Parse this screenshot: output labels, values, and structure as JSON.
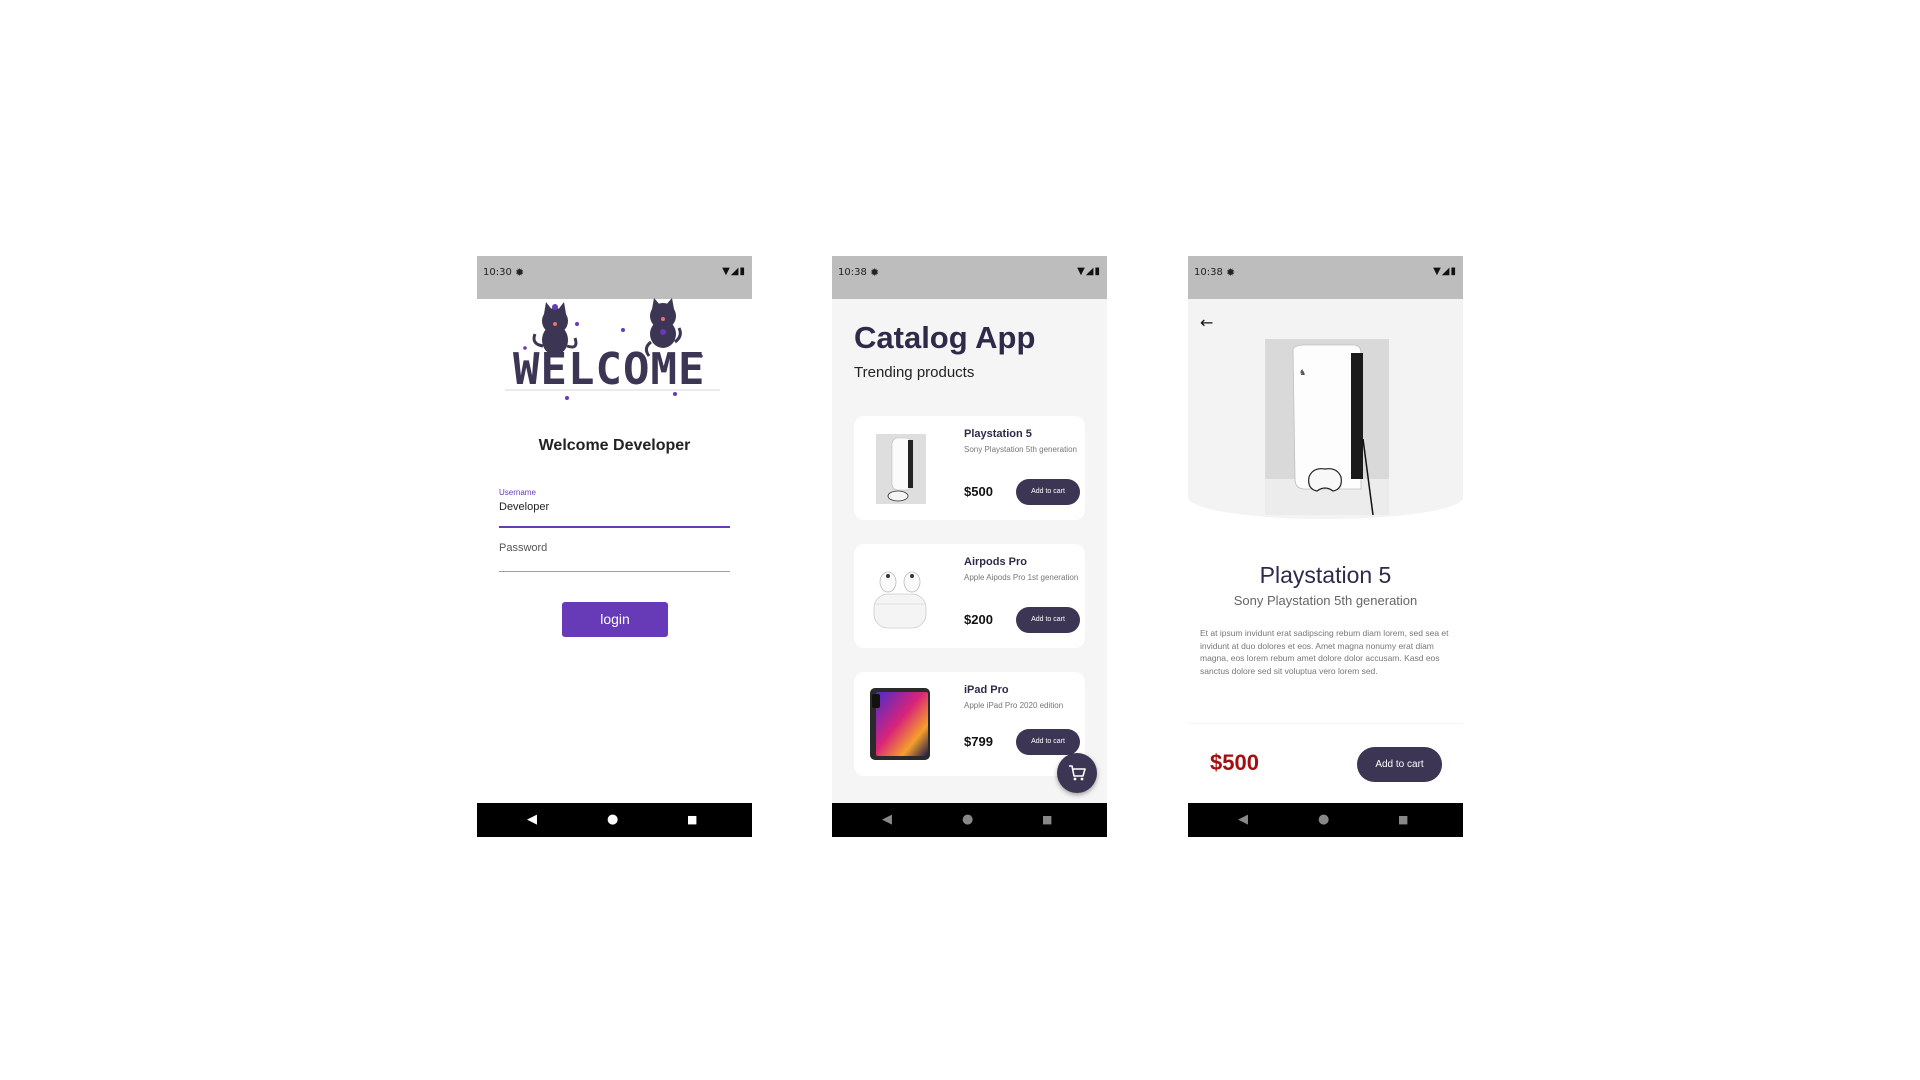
{
  "colors": {
    "primary": "#673ab7",
    "dark_button": "#3c3553",
    "title_text": "#2f2a4a",
    "price_red": "#a40e0e",
    "status_bar": "#bdbdbd"
  },
  "login_screen": {
    "status": {
      "time": "10:30",
      "settings_icon": "gear-icon",
      "right_icons": "wifi-signal-battery-icons"
    },
    "welcome_art_text": "WELCOME",
    "title": "Welcome Developer",
    "username": {
      "label": "Username",
      "value": "Developer"
    },
    "password": {
      "placeholder": "Password"
    },
    "login_button": "login"
  },
  "catalog_screen": {
    "status": {
      "time": "10:38"
    },
    "title": "Catalog App",
    "subtitle": "Trending products",
    "products": [
      {
        "name": "Playstation 5",
        "desc": "Sony Playstation 5th generation",
        "price": "$500",
        "button": "Add to cart"
      },
      {
        "name": "Airpods Pro",
        "desc": "Apple Aipods Pro 1st generation",
        "price": "$200",
        "button": "Add to cart"
      },
      {
        "name": "iPad Pro",
        "desc": "Apple iPad Pro 2020 edition",
        "price": "$799",
        "button": "Add to cart"
      }
    ],
    "fab_icon": "cart-icon"
  },
  "detail_screen": {
    "status": {
      "time": "10:38"
    },
    "name": "Playstation 5",
    "subtitle": "Sony Playstation 5th generation",
    "description": "Et at ipsum invidunt erat sadipscing rebum diam lorem, sed sea et invidunt at duo dolores et eos. Amet magna nonumy erat diam magna, eos lorem rebum amet dolore dolor accusam. Kasd eos sanctus dolore sed sit voluptua vero lorem sed.",
    "price": "$500",
    "add_button": "Add to cart"
  }
}
